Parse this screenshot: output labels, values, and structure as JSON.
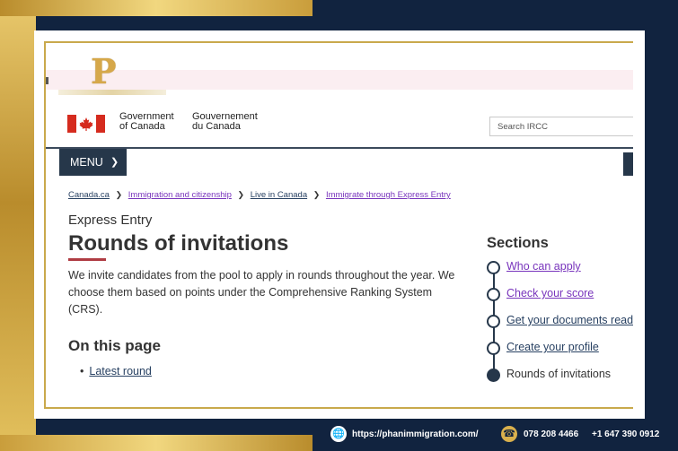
{
  "brand": {
    "logo_letter": "P"
  },
  "gc_header": {
    "wordmark_en_1": "Government",
    "wordmark_en_2": "of Canada",
    "wordmark_fr_1": "Gouvernement",
    "wordmark_fr_2": "du Canada",
    "search_placeholder": "Search IRCC"
  },
  "nav": {
    "menu_label": "MENU"
  },
  "breadcrumb": [
    {
      "label": "Canada.ca",
      "visited": false
    },
    {
      "label": "Immigration and citizenship",
      "visited": true
    },
    {
      "label": "Live in Canada",
      "visited": false
    },
    {
      "label": "Immigrate through Express Entry",
      "visited": true
    }
  ],
  "main": {
    "kicker": "Express Entry",
    "title": "Rounds of invitations",
    "intro": "We invite candidates from the pool to apply in rounds throughout the year. We choose them based on points under the Comprehensive Ranking System (CRS).",
    "on_this_page_heading": "On this page",
    "toc": [
      "Latest round"
    ]
  },
  "sections": {
    "heading": "Sections",
    "steps": [
      {
        "label": "Who can apply",
        "link": true,
        "visited": true
      },
      {
        "label": "Check your score",
        "link": true,
        "visited": true
      },
      {
        "label": "Get your documents read",
        "link": true,
        "visited": false
      },
      {
        "label": "Create your profile",
        "link": true,
        "visited": false
      },
      {
        "label": "Rounds of invitations",
        "link": false,
        "visited": false
      }
    ]
  },
  "footer_bar": {
    "website": "https://phanimmigration.com/",
    "phone_1": "078 208 4466",
    "phone_2": "+1 647 390 0912"
  },
  "colors": {
    "background_navy": "#11233f",
    "gold": "#c9a94c",
    "canada_red": "#d52b1e",
    "link_blue": "#284162",
    "visited_purple": "#7834bc"
  }
}
